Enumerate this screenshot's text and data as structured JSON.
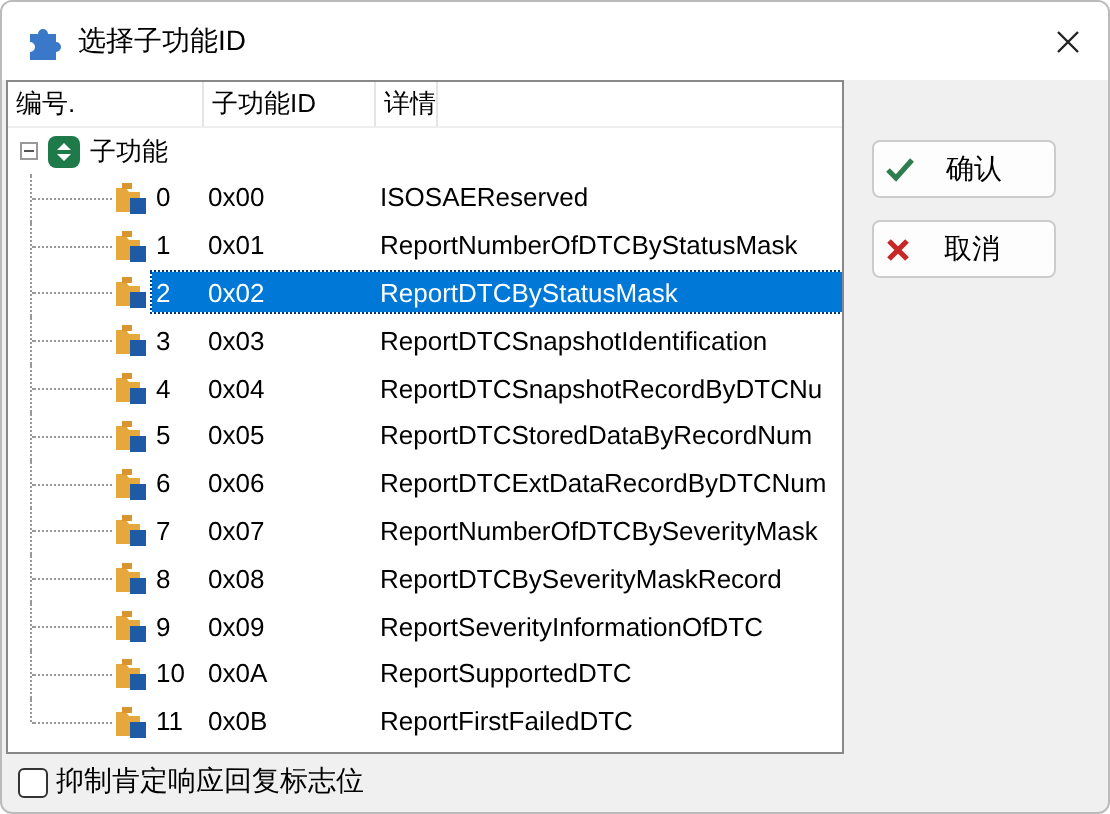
{
  "window": {
    "title": "选择子功能ID"
  },
  "columns": [
    "编号.",
    "子功能ID",
    "详情"
  ],
  "tree": {
    "label": "子功能",
    "expanded": true,
    "children": [
      {
        "number": "0",
        "id": "0x00",
        "detail": "ISOSAEReserved",
        "selected": false
      },
      {
        "number": "1",
        "id": "0x01",
        "detail": "ReportNumberOfDTCByStatusMask",
        "selected": false
      },
      {
        "number": "2",
        "id": "0x02",
        "detail": "ReportDTCByStatusMask",
        "selected": true
      },
      {
        "number": "3",
        "id": "0x03",
        "detail": "ReportDTCSnapshotIdentification",
        "selected": false
      },
      {
        "number": "4",
        "id": "0x04",
        "detail": "ReportDTCSnapshotRecordByDTCNu",
        "selected": false
      },
      {
        "number": "5",
        "id": "0x05",
        "detail": "ReportDTCStoredDataByRecordNum",
        "selected": false
      },
      {
        "number": "6",
        "id": "0x06",
        "detail": "ReportDTCExtDataRecordByDTCNum",
        "selected": false
      },
      {
        "number": "7",
        "id": "0x07",
        "detail": "ReportNumberOfDTCBySeverityMask",
        "selected": false
      },
      {
        "number": "8",
        "id": "0x08",
        "detail": "ReportDTCBySeverityMaskRecord",
        "selected": false
      },
      {
        "number": "9",
        "id": "0x09",
        "detail": "ReportSeverityInformationOfDTC",
        "selected": false
      },
      {
        "number": "10",
        "id": "0x0A",
        "detail": "ReportSupportedDTC",
        "selected": false
      },
      {
        "number": "11",
        "id": "0x0B",
        "detail": "ReportFirstFailedDTC",
        "selected": false
      }
    ]
  },
  "buttons": [
    {
      "label": "确认",
      "kind": "ok"
    },
    {
      "label": "取消",
      "kind": "cancel"
    }
  ],
  "checkbox": {
    "label": "抑制肯定响应回复标志位",
    "checked": false
  }
}
